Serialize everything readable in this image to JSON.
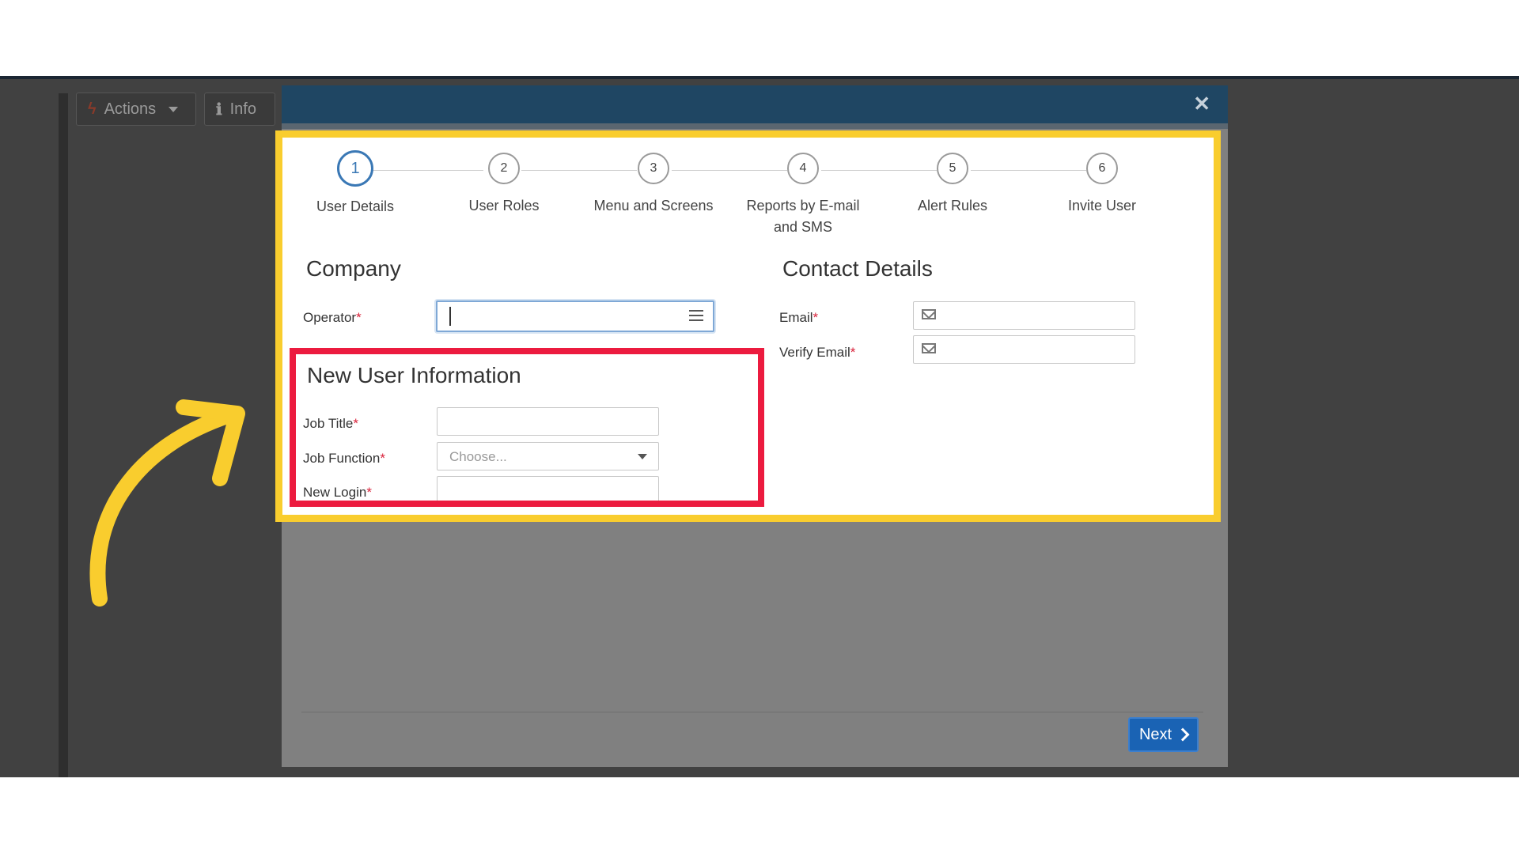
{
  "background": {
    "actions_label": "Actions",
    "info_label": "Info"
  },
  "stepper": {
    "steps": [
      {
        "number": "1",
        "label": "User Details"
      },
      {
        "number": "2",
        "label": "User Roles"
      },
      {
        "number": "3",
        "label": "Menu and Screens"
      },
      {
        "number": "4",
        "label": "Reports by E-mail and SMS"
      },
      {
        "number": "5",
        "label": "Alert Rules"
      },
      {
        "number": "6",
        "label": "Invite User"
      }
    ],
    "active": "1"
  },
  "company": {
    "title": "Company",
    "operator_label": "Operator",
    "operator_value": ""
  },
  "new_user": {
    "title": "New User Information",
    "job_title_label": "Job Title",
    "job_function_label": "Job Function",
    "job_function_placeholder": "Choose...",
    "new_login_label": "New Login"
  },
  "contact": {
    "title": "Contact Details",
    "email_label": "Email",
    "verify_email_label": "Verify Email"
  },
  "required_marker": "*",
  "footer": {
    "next_label": "Next"
  },
  "colors": {
    "highlight_yellow": "#f9cd2e",
    "highlight_red": "#ec1b3f",
    "header_blue": "#1f4663",
    "next_blue": "#1a63b4",
    "active_step": "#3a78b5"
  },
  "icons": {
    "close": "close-icon",
    "list": "list-icon",
    "mail": "mail-icon",
    "arrow": "curved-arrow-icon"
  }
}
